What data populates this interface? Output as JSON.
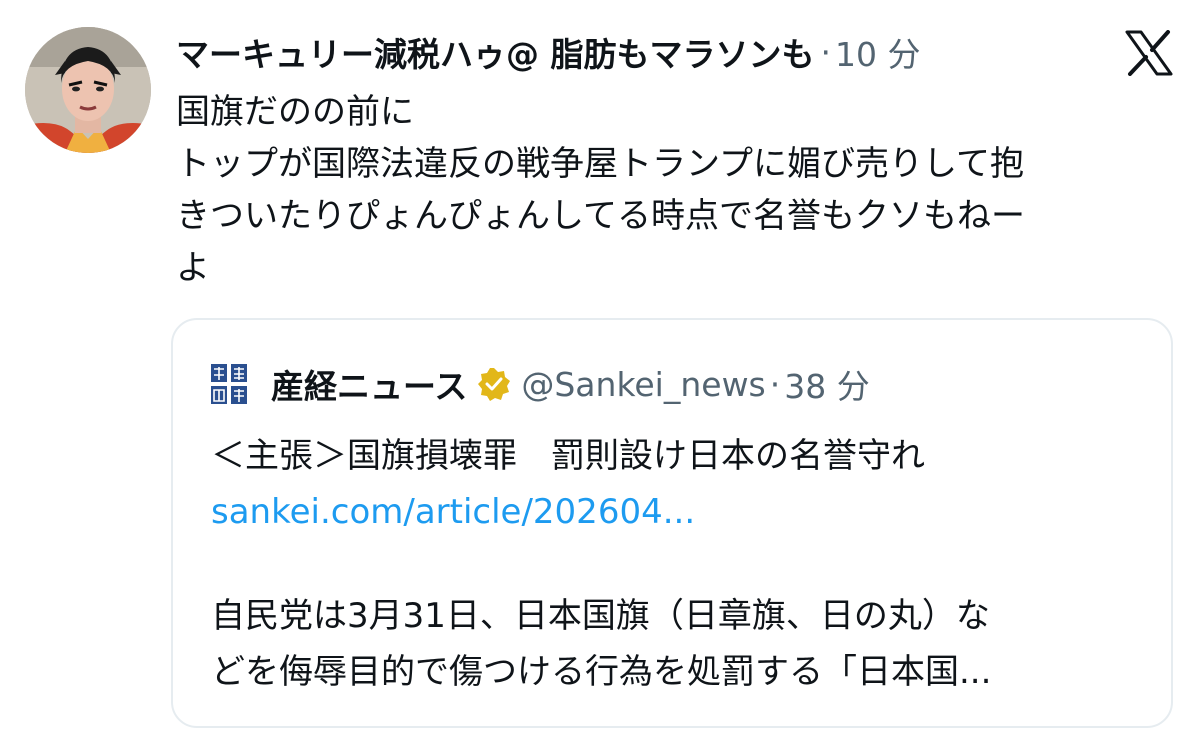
{
  "tweet": {
    "author": {
      "display_name": "マーキュリー減税ハゥ@ 脂肪もマラソンも",
      "avatar_icon": "user-avatar-icon"
    },
    "separator": "·",
    "time": "10 分",
    "platform_logo_icon": "x-logo-icon",
    "text_lines": [
      "国旗だのの前に",
      "トップが国際法違反の戦争屋トランプに媚び売りして抱",
      "きついたりぴょんぴょんしてる時点で名誉もクソもねー",
      "よ"
    ]
  },
  "quote": {
    "logo_icon": "sankei-logo-icon",
    "name": "産経ニュース",
    "verified_icon": "verified-badge-icon",
    "handle": "@Sankei_news",
    "separator": "·",
    "time": "38 分",
    "headline": "＜主張＞国旗損壊罪　罰則設け日本の名誉守れ",
    "link": "sankei.com/article/202604...",
    "body_lines": [
      "自民党は3月31日、日本国旗（日章旗、日の丸）な",
      "どを侮辱目的で傷つける行為を処罰する「日本国..."
    ]
  },
  "colors": {
    "text": "#0f1419",
    "secondary": "#536471",
    "link": "#1d9bf0",
    "verified_gold": "#e2b719",
    "border": "#e6ecf0"
  }
}
